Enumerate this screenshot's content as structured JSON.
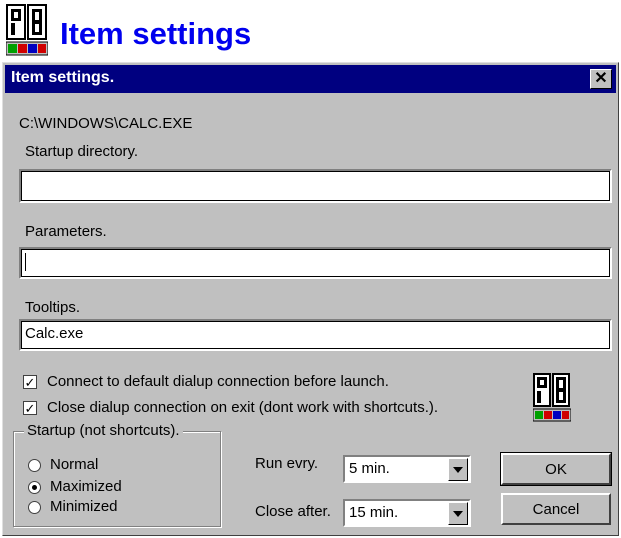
{
  "header": {
    "title": "Item settings",
    "logo_icon": "pb-logo-icon"
  },
  "dialog": {
    "title": "Item settings.",
    "close_icon": "close-icon",
    "file_path": "C:\\WINDOWS\\CALC.EXE",
    "startup_directory": {
      "label": "Startup directory.",
      "value": ""
    },
    "parameters": {
      "label": "Parameters.",
      "value": ""
    },
    "tooltips": {
      "label": "Tooltips.",
      "value": "Calc.exe"
    },
    "checkboxes": [
      {
        "label": "Connect to default dialup connection before launch.",
        "checked": true
      },
      {
        "label": "Close dialup connection on exit (dont work with shortcuts.).",
        "checked": true
      }
    ],
    "startup_group": {
      "legend": "Startup (not shortcuts).",
      "options": [
        "Normal",
        "Maximized",
        "Minimized"
      ],
      "selected": "Maximized"
    },
    "run_every": {
      "label": "Run evry.",
      "value": "5 min."
    },
    "close_after": {
      "label": "Close after.",
      "value": "15 min."
    },
    "buttons": {
      "ok": "OK",
      "cancel": "Cancel"
    }
  },
  "colors": {
    "titlebar": "#000080",
    "face": "#c0c0c0",
    "link_title": "#0000ee"
  }
}
